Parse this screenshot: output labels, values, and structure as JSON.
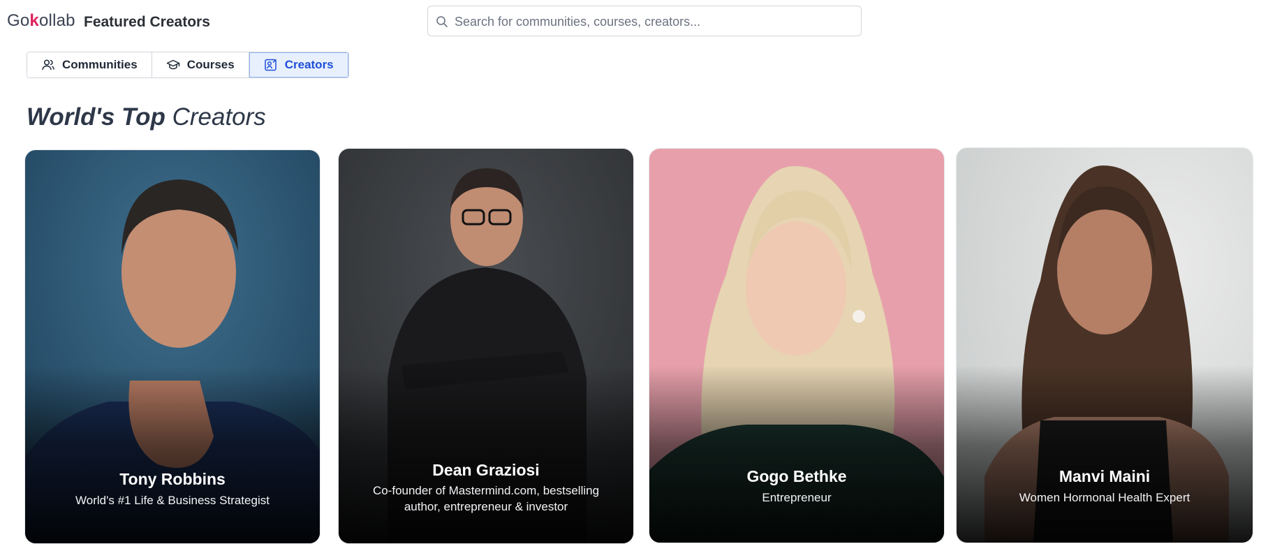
{
  "header": {
    "logo_text_pre": "Go",
    "logo_text_k": "k",
    "logo_text_post": "ollab",
    "page_title": "Featured Creators",
    "search": {
      "placeholder": "Search for communities, courses, creators...",
      "value": "",
      "icon": "search-icon"
    }
  },
  "tabs": [
    {
      "label": "Communities",
      "icon": "users-icon",
      "active": false
    },
    {
      "label": "Courses",
      "icon": "graduation-cap-icon",
      "active": false
    },
    {
      "label": "Creators",
      "icon": "creator-icon",
      "active": true
    }
  ],
  "section": {
    "title_bold": "World's Top",
    "title_rest": "Creators"
  },
  "creators": [
    {
      "name": "Tony Robbins",
      "description": "World's #1 Life & Business Strategist"
    },
    {
      "name": "Dean Graziosi",
      "description": "Co-founder of Mastermind.com, bestselling author, entrepreneur & investor"
    },
    {
      "name": "Gogo Bethke",
      "description": "Entrepreneur"
    },
    {
      "name": "Manvi Maini",
      "description": "Women Hormonal Health Expert"
    }
  ],
  "colors": {
    "accent": "#1d4ed8",
    "active_tab_bg": "#e8f0fe",
    "logo_k": "#e0245e"
  }
}
